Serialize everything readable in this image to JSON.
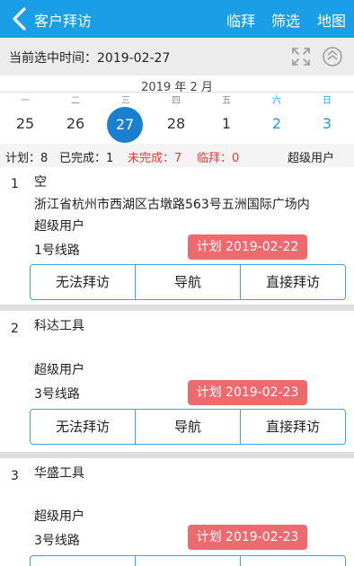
{
  "header": {
    "title": "客户拜访",
    "btn_temp": "临拜",
    "btn_filter": "筛选",
    "btn_map": "地图"
  },
  "datebar": {
    "label": "当前选中时间：2019-02-27"
  },
  "calendar": {
    "month": "2019 年 2 月",
    "weekdays": [
      "一",
      "二",
      "三",
      "四",
      "五",
      "六",
      "日"
    ],
    "days": [
      "25",
      "26",
      "27",
      "28",
      "1",
      "2",
      "3"
    ],
    "selected": "27"
  },
  "stats": {
    "plan": "计划：8",
    "done": "已完成：1",
    "undone": "未完成：7",
    "temp": "临拜：0",
    "user": "超级用户"
  },
  "visits": [
    {
      "index": "1",
      "name": "空",
      "address": "浙江省杭州市西湖区古墩路563号五洲国际广场内",
      "user": "超级用户",
      "route": "1号线路",
      "plan": "计划 2019-02-22"
    },
    {
      "index": "2",
      "name": "科达工具",
      "address": "",
      "user": "超级用户",
      "route": "3号线路",
      "plan": "计划 2019-02-23"
    },
    {
      "index": "3",
      "name": "华盛工具",
      "address": "",
      "user": "超级用户",
      "route": "3号线路",
      "plan": "计划 2019-02-23"
    }
  ],
  "actions": {
    "cannot": "无法拜访",
    "navigate": "导航",
    "direct": "直接拜访"
  },
  "colors": {
    "primary": "#1a9ee6",
    "selected_day": "#1a7fd0",
    "badge": "#ef6a6e",
    "alert": "#e8383b"
  }
}
